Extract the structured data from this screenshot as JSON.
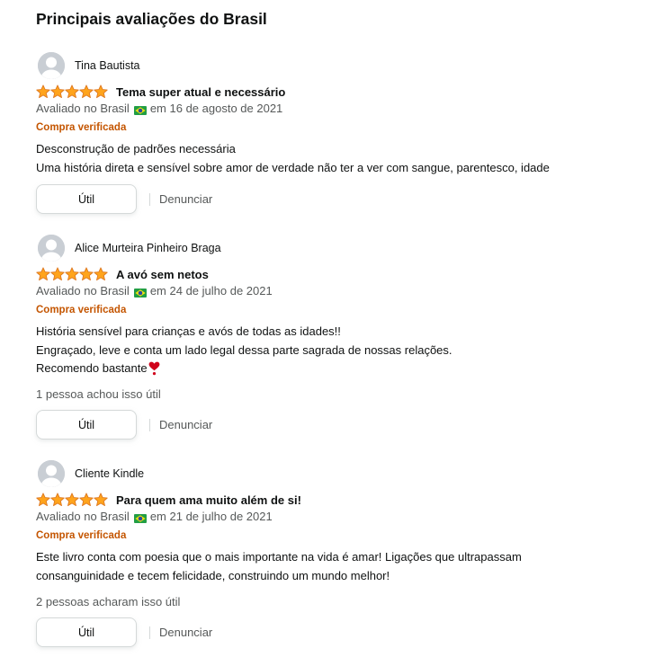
{
  "section": {
    "title": "Principais avaliações do Brasil"
  },
  "colors": {
    "star": "#ffa41c",
    "verified": "#c45500",
    "muted": "#565959"
  },
  "reviews": [
    {
      "reviewer": "Tina Bautista",
      "rating": 5,
      "title": "Tema super atual e necessário",
      "date_prefix": "Avaliado no Brasil",
      "date_suffix": "em 16 de agosto de 2021",
      "verified": "Compra verificada",
      "body": [
        "Desconstrução de padrões necessária",
        "Uma história direta e sensível sobre amor de verdade não ter a ver com sangue, parentesco, idade"
      ],
      "helpful": "",
      "helpful_label": "Útil",
      "report_label": "Denunciar"
    },
    {
      "reviewer": "Alice Murteira Pinheiro Braga",
      "rating": 5,
      "title": "A avó sem netos",
      "date_prefix": "Avaliado no Brasil",
      "date_suffix": "em 24 de julho de 2021",
      "verified": "Compra verificada",
      "body": [
        "História sensível para crianças e avós de todas as idades!!",
        "Engraçado, leve e conta um lado legal dessa parte sagrada de nossas relações.",
        "Recomendo bastante"
      ],
      "body_emoji": "heart-exclamation-icon",
      "helpful": "1 pessoa achou isso útil",
      "helpful_label": "Útil",
      "report_label": "Denunciar"
    },
    {
      "reviewer": "Cliente Kindle",
      "rating": 5,
      "title": "Para quem ama muito além de si!",
      "date_prefix": "Avaliado no Brasil",
      "date_suffix": "em 21 de julho de 2021",
      "verified": "Compra verificada",
      "body": [
        "Este livro conta com poesia que o mais importante na vida é amar! Ligações que ultrapassam",
        "consanguinidade e tecem felicidade, construindo um mundo melhor!"
      ],
      "helpful": "2 pessoas acharam isso útil",
      "helpful_label": "Útil",
      "report_label": "Denunciar"
    }
  ]
}
